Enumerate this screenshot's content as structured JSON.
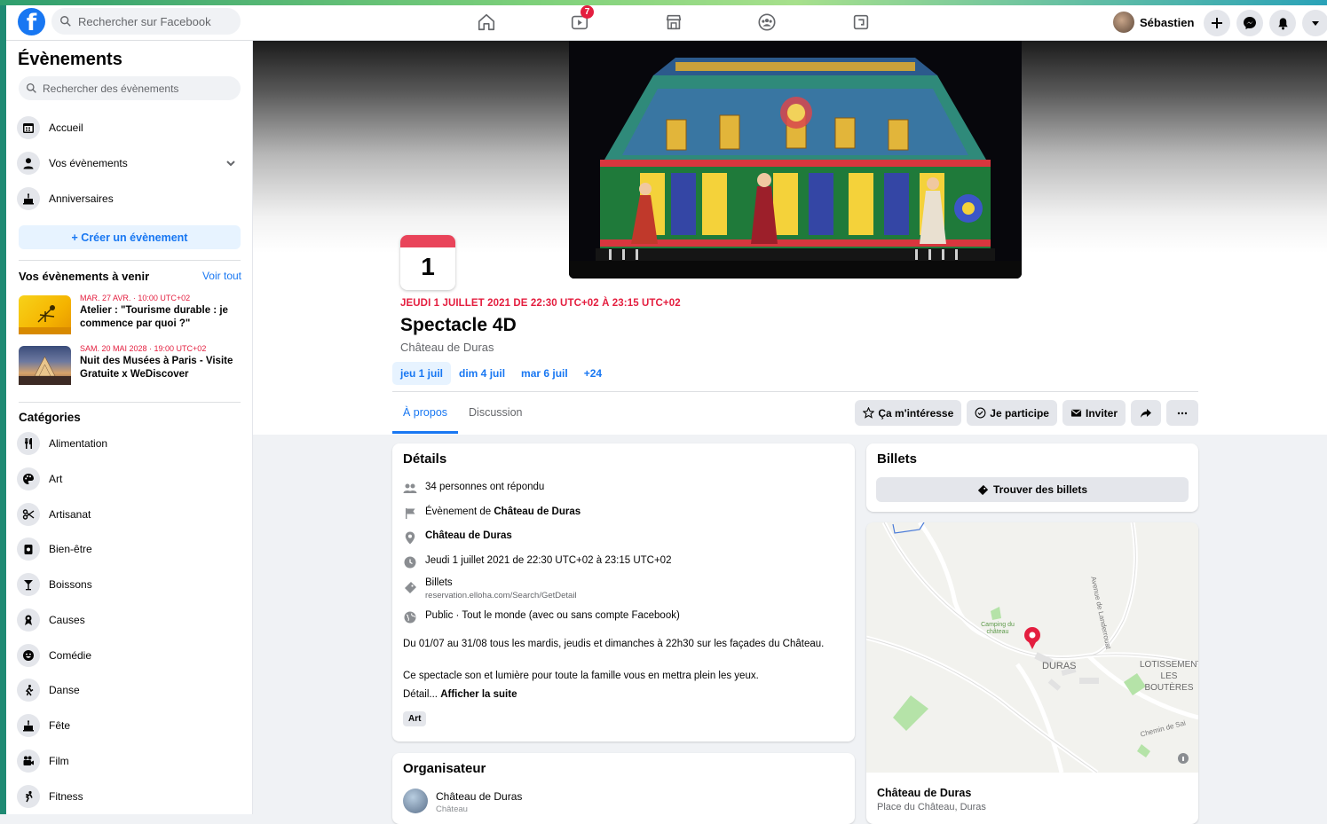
{
  "header": {
    "search_placeholder": "Rechercher sur Facebook",
    "watch_badge": "7",
    "profile_name": "Sébastien",
    "brand_color": "#1877f2"
  },
  "sidebar": {
    "title": "Évènements",
    "search_placeholder": "Rechercher des évènements",
    "nav": [
      {
        "label": "Accueil",
        "icon": "calendar-icon"
      },
      {
        "label": "Vos évènements",
        "icon": "person-icon"
      },
      {
        "label": "Anniversaires",
        "icon": "cake-icon"
      }
    ],
    "create_label": "+ Créer un évènement",
    "upcoming_title": "Vos évènements à venir",
    "see_all": "Voir tout",
    "upcoming": [
      {
        "when": "MAR. 27 AVR. · 10:00 UTC+02",
        "name": "Atelier : \"Tourisme durable : je commence par quoi ?\""
      },
      {
        "when": "SAM. 20 MAI 2028 · 19:00 UTC+02",
        "name": "Nuit des Musées à Paris - Visite Gratuite x WeDiscover"
      }
    ],
    "categories_title": "Catégories",
    "categories": [
      {
        "label": "Alimentation",
        "icon": "fork-knife-icon"
      },
      {
        "label": "Art",
        "icon": "palette-icon"
      },
      {
        "label": "Artisanat",
        "icon": "scissors-icon"
      },
      {
        "label": "Bien-être",
        "icon": "wellness-icon"
      },
      {
        "label": "Boissons",
        "icon": "cocktail-icon"
      },
      {
        "label": "Causes",
        "icon": "ribbon-icon"
      },
      {
        "label": "Comédie",
        "icon": "smile-icon"
      },
      {
        "label": "Danse",
        "icon": "dance-icon"
      },
      {
        "label": "Fête",
        "icon": "party-cake-icon"
      },
      {
        "label": "Film",
        "icon": "film-camera-icon"
      },
      {
        "label": "Fitness",
        "icon": "fitness-icon"
      }
    ]
  },
  "event": {
    "calendar_day": "1",
    "date_line": "JEUDI 1 JUILLET 2021 DE 22:30 UTC+02 À 23:15 UTC+02",
    "title": "Spectacle 4D",
    "location": "Château de Duras",
    "date_tabs": [
      "jeu 1 juil",
      "dim 4 juil",
      "mar 6 juil",
      "+24"
    ],
    "tabs": [
      "À propos",
      "Discussion"
    ],
    "actions": {
      "interested": "Ça m'intéresse",
      "going": "Je participe",
      "invite": "Inviter"
    }
  },
  "details": {
    "title": "Détails",
    "responded": "34 personnes ont répondu",
    "event_by_prefix": "Évènement de ",
    "event_by_name": "Château de Duras",
    "place": "Château de Duras",
    "datetime": "Jeudi 1 juillet 2021 de 22:30 UTC+02 à 23:15 UTC+02",
    "tickets_label": "Billets",
    "tickets_url": "reservation.elloha.com/Search/GetDetail",
    "privacy": "Public · Tout le monde (avec ou sans compte Facebook)",
    "desc1": "Du 01/07 au 31/08 tous les mardis, jeudis et dimanches à 22h30 sur les façades du Château.",
    "desc2": "Ce spectacle son et lumière pour toute la famille vous en mettra plein les yeux.",
    "detail_prefix": "Détail... ",
    "see_more": "Afficher la suite",
    "tag": "Art"
  },
  "organizer": {
    "title": "Organisateur",
    "name": "Château de Duras",
    "type": "Château"
  },
  "tickets": {
    "title": "Billets",
    "button": "Trouver des billets"
  },
  "map": {
    "labels": {
      "camping": "Camping du château",
      "duras": "DURAS",
      "lotissement": "LOTISSEMENT LES BOUTÈRES",
      "avenue": "Avenue de Landerrouat",
      "chemin": "Chemin de Sai"
    },
    "place_name": "Château de Duras",
    "place_address": "Place du Château, Duras"
  }
}
